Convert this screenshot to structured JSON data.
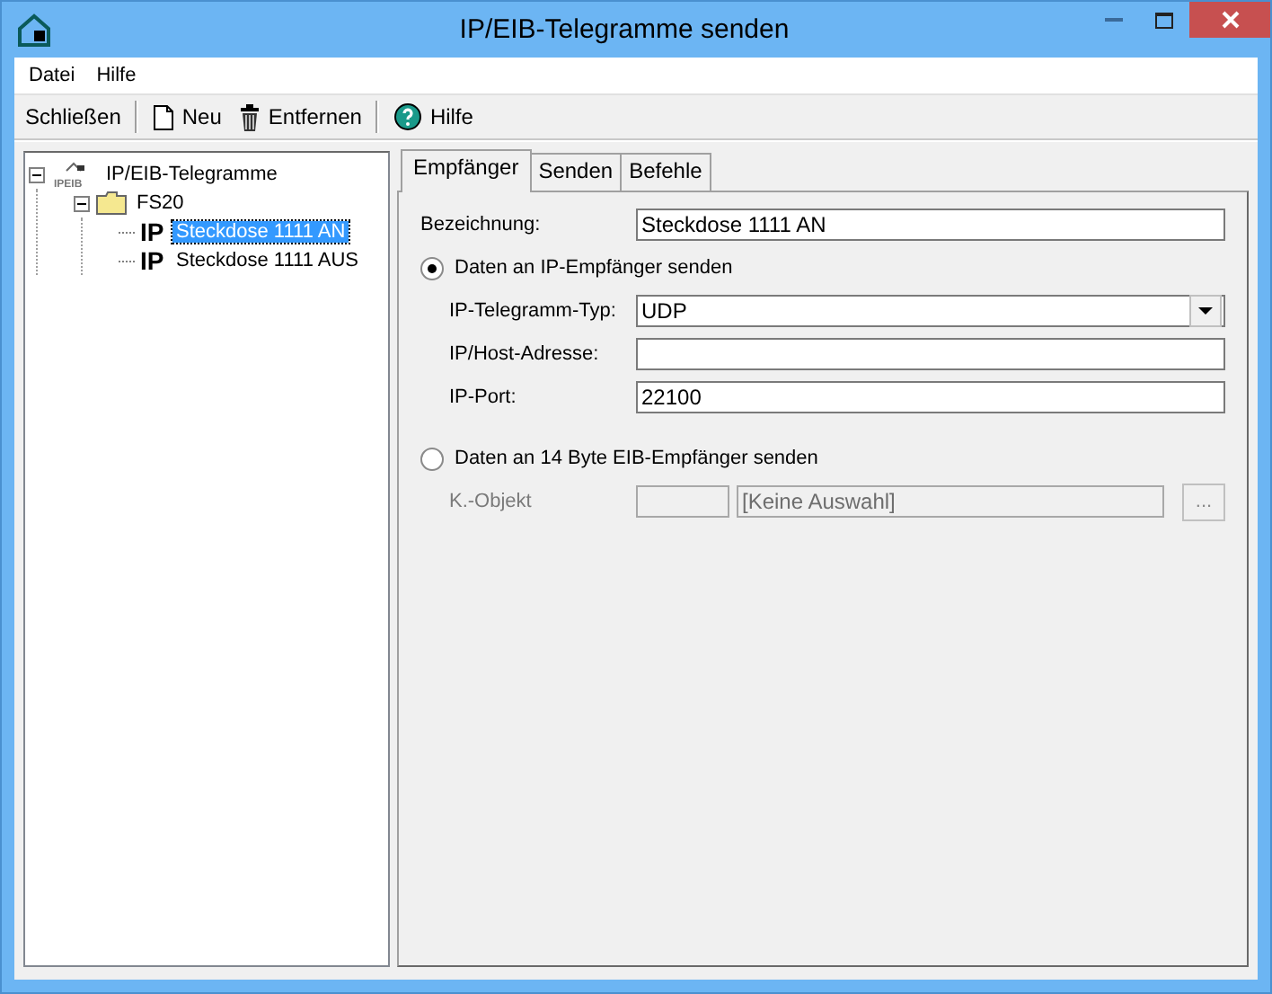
{
  "window": {
    "title": "IP/EIB-Telegramme senden"
  },
  "menu": [
    {
      "label": "Datei"
    },
    {
      "label": "Hilfe"
    }
  ],
  "toolbar": [
    {
      "label": "Schließen",
      "kind": "text"
    },
    {
      "label": "Neu",
      "kind": "new"
    },
    {
      "label": "Entfernen",
      "kind": "delete"
    },
    {
      "label": "Hilfe",
      "kind": "help"
    }
  ],
  "tree": {
    "label": "IP/EIB-Telegramme",
    "icon_text": "IPEIB",
    "expanded": true,
    "children": [
      {
        "label": "FS20",
        "expanded": true,
        "children": [
          {
            "label": "Steckdose 1111 AN",
            "badge": "IP",
            "selected": true
          },
          {
            "label": "Steckdose 1111 AUS",
            "badge": "IP",
            "selected": false
          }
        ]
      }
    ]
  },
  "tabs": [
    {
      "label": "Empfänger",
      "selected": true
    },
    {
      "label": "Senden",
      "selected": false
    },
    {
      "label": "Befehle",
      "selected": false
    }
  ],
  "name_field": {
    "label": "Bezeichnung:",
    "value": "Steckdose 1111 AN"
  },
  "receivers": [
    {
      "label": "Daten an IP-Empfänger senden",
      "selected": true,
      "fields": [
        {
          "kind": "select",
          "label": "IP-Telegramm-Typ:",
          "value": "UDP",
          "disabled": false
        },
        {
          "kind": "text",
          "label": "IP/Host-Adresse:",
          "disabled": false
        },
        {
          "kind": "text",
          "label": "IP-Port:",
          "value": "22100",
          "disabled": false
        }
      ]
    },
    {
      "label": "Daten an 14 Byte EIB-Empfänger senden",
      "selected": false,
      "fields": [
        {
          "kind": "object",
          "label": "K.-Objekt",
          "value": "[Keine Auswahl]",
          "button": "...",
          "disabled": true
        }
      ]
    }
  ]
}
